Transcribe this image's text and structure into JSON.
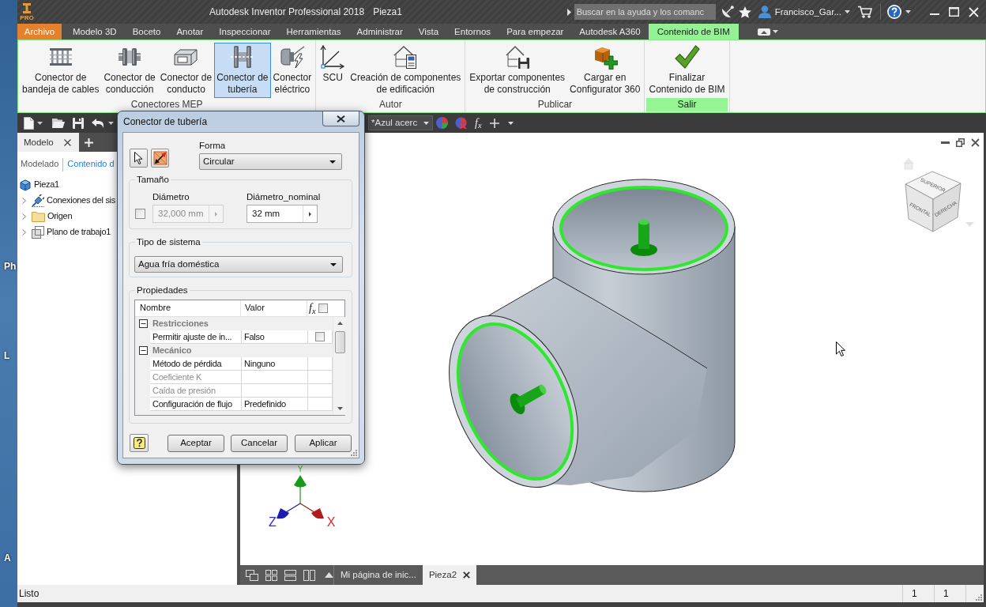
{
  "desktop_labels": [
    "Ph",
    "L",
    "A"
  ],
  "title_bar": {
    "logo_text": "PRO",
    "app_title": "Autodesk Inventor Professional 2018",
    "document_title": "Pieza1",
    "search": {
      "placeholder": "Buscar en la ayuda y los comanc"
    },
    "user_name": "Francisco_Gar..."
  },
  "ribbon_tabs": [
    {
      "label": "Archivo",
      "kind": "file",
      "selected": false
    },
    {
      "label": "Modelo 3D",
      "kind": "tab",
      "selected": false
    },
    {
      "label": "Boceto",
      "kind": "tab",
      "selected": false
    },
    {
      "label": "Anotar",
      "kind": "tab",
      "selected": false
    },
    {
      "label": "Inspeccionar",
      "kind": "tab",
      "selected": false
    },
    {
      "label": "Herramientas",
      "kind": "tab",
      "selected": false
    },
    {
      "label": "Administrar",
      "kind": "tab",
      "selected": false
    },
    {
      "label": "Vista",
      "kind": "tab",
      "selected": false
    },
    {
      "label": "Entornos",
      "kind": "tab",
      "selected": false
    },
    {
      "label": "Para empezar",
      "kind": "tab",
      "selected": false
    },
    {
      "label": "Autodesk A360",
      "kind": "tab",
      "selected": false
    },
    {
      "label": "Contenido de BIM",
      "kind": "tab",
      "selected": true
    }
  ],
  "ribbon_panels": [
    {
      "title": "Conectores MEP",
      "highlighted": false,
      "buttons": [
        {
          "label": "Conector de\nbandeja de cables",
          "selected": false
        },
        {
          "label": "Conector de\nconducción",
          "selected": false
        },
        {
          "label": "Conector de\nconducto",
          "selected": false
        },
        {
          "label": "Conector de\ntubería",
          "selected": true
        },
        {
          "label": "Conector\neléctrico",
          "selected": false
        }
      ]
    },
    {
      "title": "Autor",
      "highlighted": false,
      "buttons": [
        {
          "label": "SCU",
          "selected": false
        },
        {
          "label": "Creación de componentes\nde edificación",
          "selected": false
        }
      ]
    },
    {
      "title": "Publicar",
      "highlighted": false,
      "buttons": [
        {
          "label": "Exportar componentes\nde construcción",
          "selected": false
        },
        {
          "label": "Cargar en\nConfigurator 360",
          "selected": false
        }
      ]
    },
    {
      "title": "Salir",
      "highlighted": true,
      "buttons": [
        {
          "label": "Finalizar\nContenido de BIM",
          "selected": false
        }
      ]
    }
  ],
  "quick_access": {
    "appearance": "*Azul acerc",
    "formula": "f$_{x}$"
  },
  "browser": {
    "tab": "Modelo",
    "subtabs": [
      {
        "label": "Modelado",
        "selected": false
      },
      {
        "label": "Contenido d",
        "selected": true
      }
    ],
    "tree": [
      {
        "label": "Pieza1",
        "kind": "part",
        "children": [
          {
            "label": "Conexiones del sis",
            "kind": "connections",
            "expanded": false
          },
          {
            "label": "Origen",
            "kind": "folder",
            "expanded": false
          },
          {
            "label": "Plano de trabajo1",
            "kind": "workplane",
            "expanded": false
          }
        ]
      }
    ]
  },
  "dialog": {
    "title": "Conector de tubería",
    "shape": {
      "label": "Forma",
      "value": "Circular"
    },
    "size_group": {
      "title": "Tamaño",
      "override_checked": false,
      "diameter": {
        "label": "Diámetro",
        "value": "32,000 mm",
        "disabled": true
      },
      "nominal": {
        "label": "Diámetro_nominal",
        "value": "32 mm",
        "disabled": false
      }
    },
    "system_group": {
      "title": "Tipo de sistema",
      "value": "Agua fría doméstica"
    },
    "properties": {
      "title": "Propiedades",
      "columns": [
        "Nombre",
        "Valor"
      ],
      "formula_header": "f$_{x}$",
      "formula_checked": false,
      "rows": [
        {
          "label": "Restricciones",
          "expanded": true,
          "children": [
            {
              "name": "Permitir ajuste de in...",
              "value": "Falso",
              "disabled": false,
              "checked": false
            }
          ]
        },
        {
          "label": "Mecánico",
          "expanded": true,
          "children": [
            {
              "name": "Método de pérdida",
              "value": "Ninguno",
              "disabled": false
            },
            {
              "name": "Coeficiente K",
              "disabled": true
            },
            {
              "name": "Caída de presión",
              "disabled": true
            },
            {
              "name": "Configuración de flujo",
              "value": "Predefinido",
              "disabled": false
            }
          ]
        }
      ]
    },
    "buttons": [
      "Aceptar",
      "Cancelar",
      "Aplicar"
    ]
  },
  "viewport": {
    "view_cube": {
      "top": "SUPERIOR",
      "front": "FRONTAL",
      "right": "DERECHA"
    },
    "axis_labels": {
      "y": "Y",
      "z": "Z",
      "x": "X"
    }
  },
  "doc_tabs": [
    {
      "label": "Mi página de inic...",
      "selected": false
    },
    {
      "label": "Pieza2",
      "selected": true
    }
  ],
  "status_bar": {
    "message": "Listo",
    "fields": [
      "1",
      "1"
    ]
  }
}
